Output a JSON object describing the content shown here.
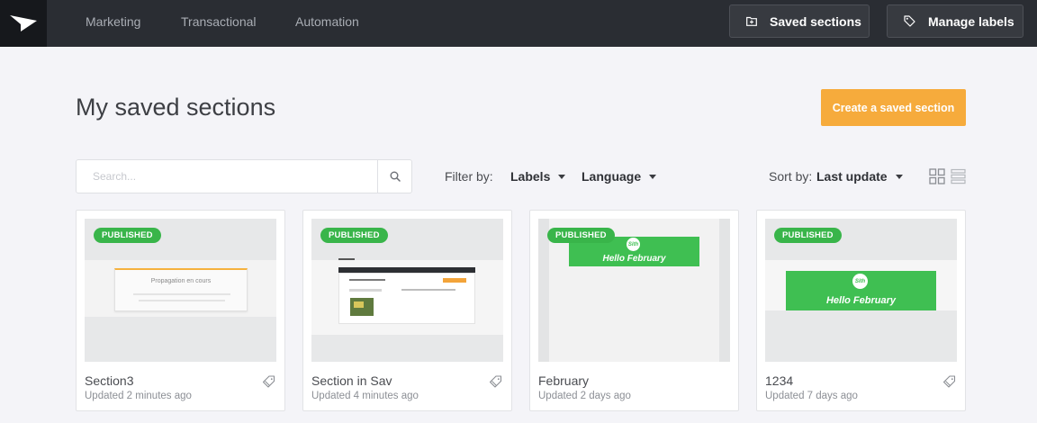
{
  "nav": {
    "items": [
      {
        "label": "Marketing"
      },
      {
        "label": "Transactional"
      },
      {
        "label": "Automation"
      }
    ],
    "saved_sections_label": "Saved sections",
    "manage_labels_label": "Manage labels"
  },
  "page": {
    "title": "My saved sections",
    "create_label": "Create a saved section"
  },
  "search": {
    "placeholder": "Search..."
  },
  "filters": {
    "filter_by": "Filter by:",
    "labels": "Labels",
    "language": "Language",
    "sort_by": "Sort by:",
    "sort_value": "Last update"
  },
  "cards": [
    {
      "badge": "PUBLISHED",
      "title": "Section3",
      "updated": "Updated 2 minutes ago",
      "thumb_text": "Propagation en cours"
    },
    {
      "badge": "PUBLISHED",
      "title": "Section in Sav",
      "updated": "Updated 4 minutes ago"
    },
    {
      "badge": "PUBLISHED",
      "title": "February",
      "updated": "Updated 2 days ago",
      "thumb_logo": "Sith",
      "thumb_text": "Hello February"
    },
    {
      "badge": "PUBLISHED",
      "title": "1234",
      "updated": "Updated 7 days ago",
      "thumb_logo": "Sith",
      "thumb_text": "Hello February"
    }
  ],
  "colors": {
    "topbar": "#2a2d33",
    "accent_orange": "#f6ab3c",
    "published_green": "#39b54a"
  },
  "icons": [
    "logo-icon",
    "folder-icon",
    "tag-icon",
    "search-icon",
    "grid-view-icon",
    "list-view-icon"
  ]
}
